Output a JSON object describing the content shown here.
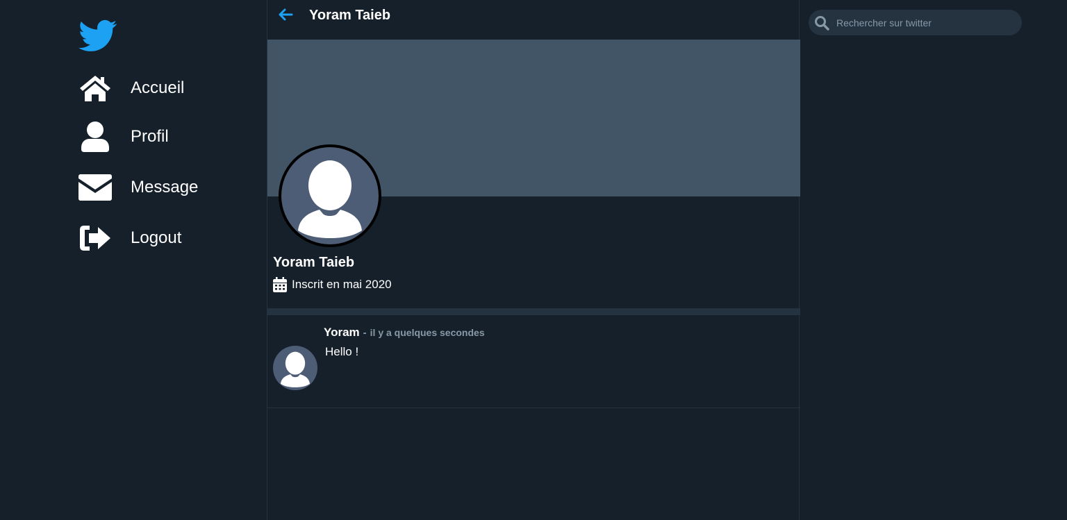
{
  "colors": {
    "background": "#15202b",
    "accent": "#1da1f2",
    "banner": "#425566",
    "avatar_bg": "#4e5d76",
    "border": "#253341",
    "muted_text": "#8899a6"
  },
  "sidebar": {
    "logo_icon": "twitter-bird-icon",
    "items": [
      {
        "label": "Accueil",
        "icon": "home-icon"
      },
      {
        "label": "Profil",
        "icon": "user-icon"
      },
      {
        "label": "Message",
        "icon": "envelope-icon"
      },
      {
        "label": "Logout",
        "icon": "logout-icon"
      }
    ]
  },
  "header": {
    "back_icon": "arrow-left-icon",
    "title": "Yoram Taieb"
  },
  "profile": {
    "name": "Yoram Taieb",
    "joined_icon": "calendar-icon",
    "joined": "Inscrit en mai 2020"
  },
  "tweets": [
    {
      "author": "Yoram",
      "separator": "-",
      "time": "il y a quelques secondes",
      "text": "Hello !"
    }
  ],
  "search": {
    "placeholder": "Rechercher sur twitter",
    "value": ""
  }
}
